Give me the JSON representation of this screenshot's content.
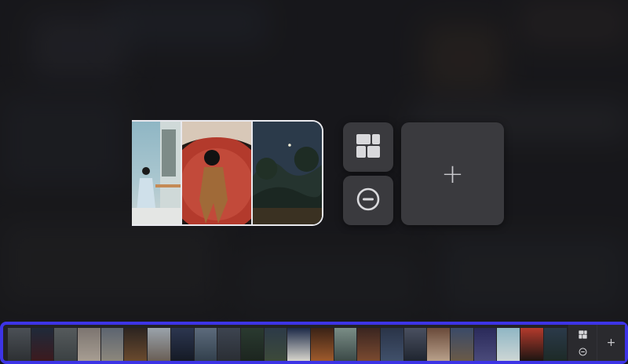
{
  "icons": {
    "layout": "layout-grid-icon",
    "remove": "minus-circle-icon",
    "add": "plus-icon"
  },
  "labels": {
    "add_symbol": "+",
    "strip_add_symbol": "+"
  },
  "colors": {
    "selection_border": "#3d34e6",
    "tile_bg": "#3a3a3e",
    "collage_border": "#e9e9ee"
  },
  "collage": {
    "photos": [
      "woman-blue-dress-balcony",
      "man-red-circle-lying",
      "moonlit-forest-landscape"
    ]
  },
  "filmstrip": {
    "thumbnail_count": 24
  }
}
